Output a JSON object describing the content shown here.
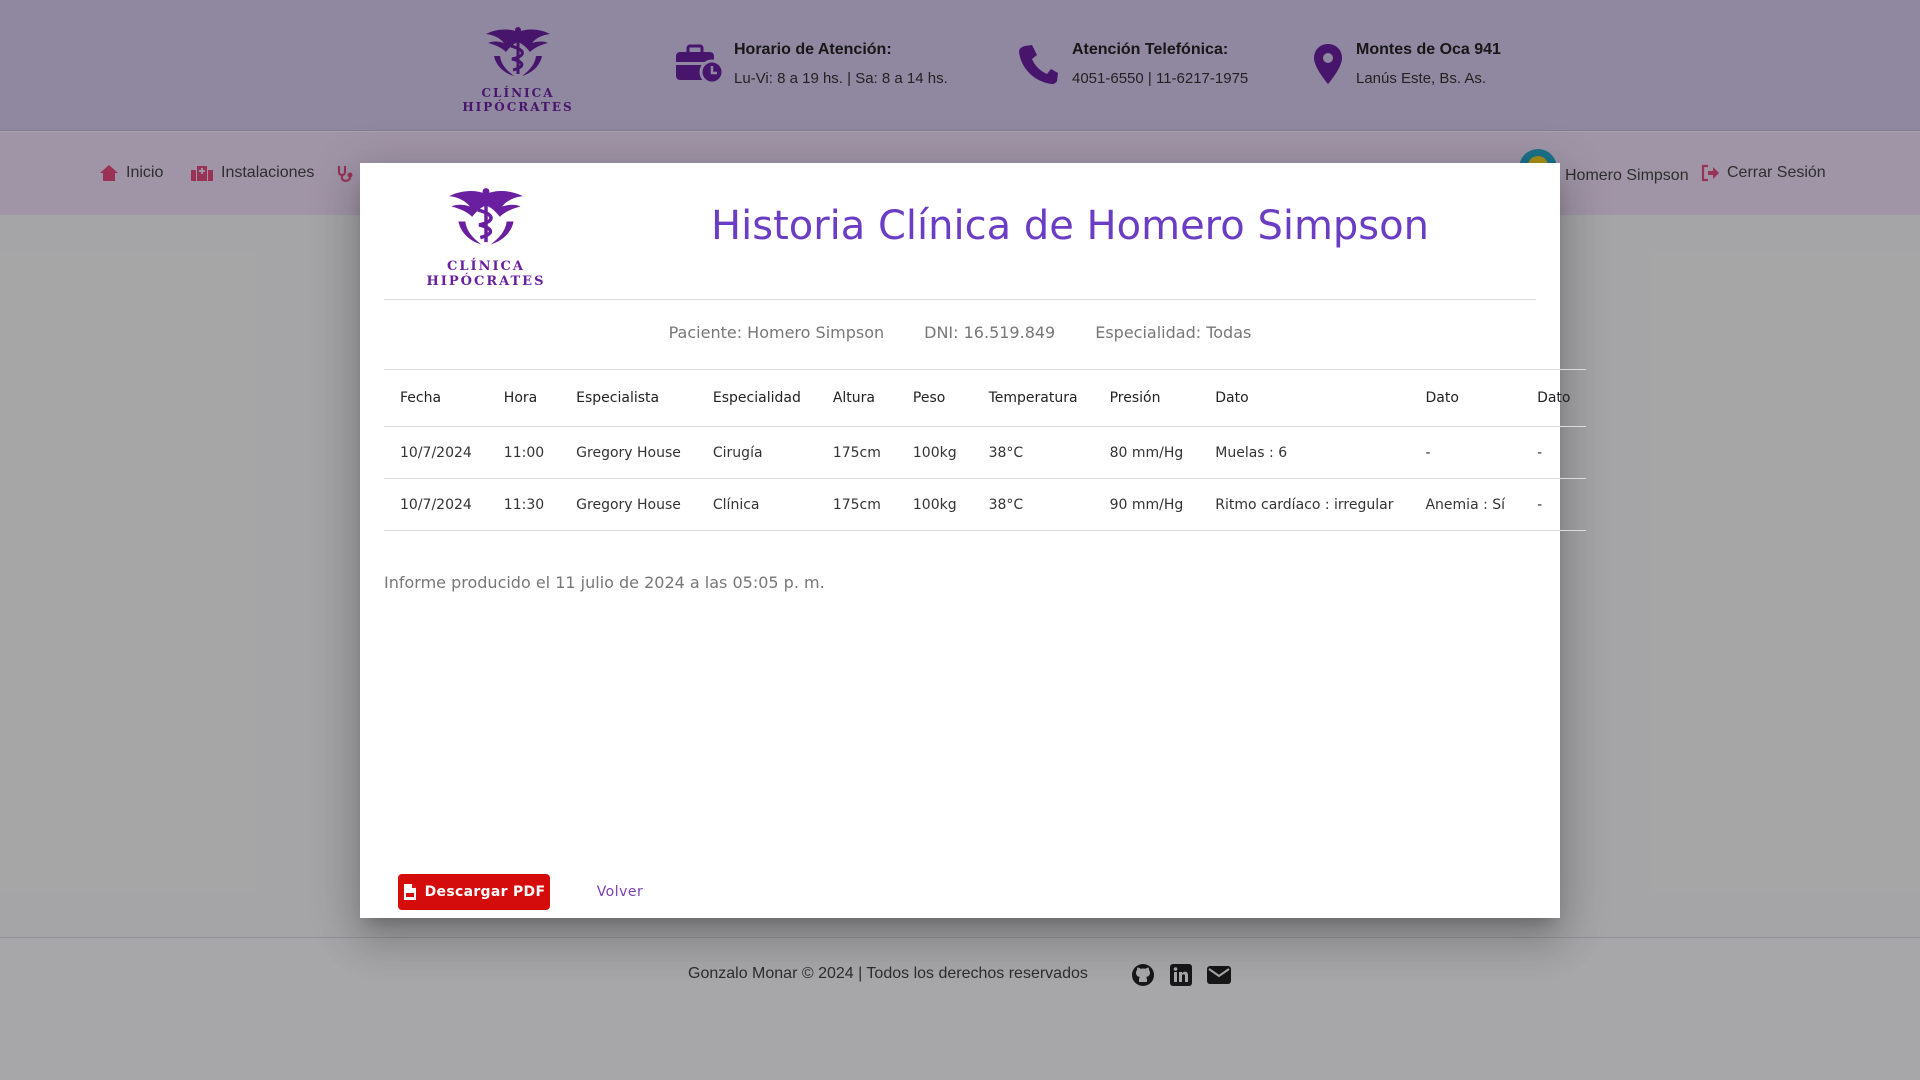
{
  "header": {
    "brand_name": "CLÍNICA HIPÓCRATES",
    "schedule": {
      "title": "Horario de Atención:",
      "text": "Lu-Vi: 8 a 19 hs. | Sa: 8 a 14 hs.",
      "icon": "briefcase-clock-icon"
    },
    "phone": {
      "title": "Atención Telefónica:",
      "text": "4051-6550 | 11-6217-1975",
      "icon": "phone-icon"
    },
    "address": {
      "title": "Montes de Oca 941",
      "text": "Lanús Este, Bs. As.",
      "icon": "location-pin-icon"
    }
  },
  "nav": {
    "items": [
      {
        "label": "Inicio",
        "icon": "home-icon"
      },
      {
        "label": "Instalaciones",
        "icon": "hospital-icon"
      }
    ],
    "user_name": "Homero Simpson",
    "logout_label": "Cerrar Sesión"
  },
  "modal": {
    "brand_name": "CLÍNICA HIPÓCRATES",
    "title": "Historia Clínica de Homero Simpson",
    "patient": "Paciente: Homero Simpson",
    "dni": "DNI: 16.519.849",
    "specialty": "Especialidad: Todas",
    "columns": [
      "Fecha",
      "Hora",
      "Especialista",
      "Especialidad",
      "Altura",
      "Peso",
      "Temperatura",
      "Presión",
      "Dato",
      "Dato",
      "Dato"
    ],
    "rows": [
      [
        "10/7/2024",
        "11:00",
        "Gregory House",
        "Cirugía",
        "175cm",
        "100kg",
        "38°C",
        "80 mm/Hg",
        "Muelas : 6",
        "-",
        "-"
      ],
      [
        "10/7/2024",
        "11:30",
        "Gregory House",
        "Clínica",
        "175cm",
        "100kg",
        "38°C",
        "90 mm/Hg",
        "Ritmo cardíaco : irregular",
        "Anemia : Sí",
        "-"
      ]
    ],
    "report": "Informe producido el 11 julio de 2024 a las 05:05 p. m.",
    "download_label": "Descargar PDF",
    "back_label": "Volver"
  },
  "footer": {
    "copyright": "Gonzalo Monar © 2024 | Todos los derechos reservados",
    "icons": [
      "github-icon",
      "linkedin-icon",
      "email-icon"
    ]
  },
  "colors": {
    "brand_purple": "#6a1fa0",
    "title_purple": "#6a3dc4",
    "pdf_red": "#d40c0c",
    "header_bg": "#d4c8ec",
    "nav_bg": "#ecdcf6"
  }
}
